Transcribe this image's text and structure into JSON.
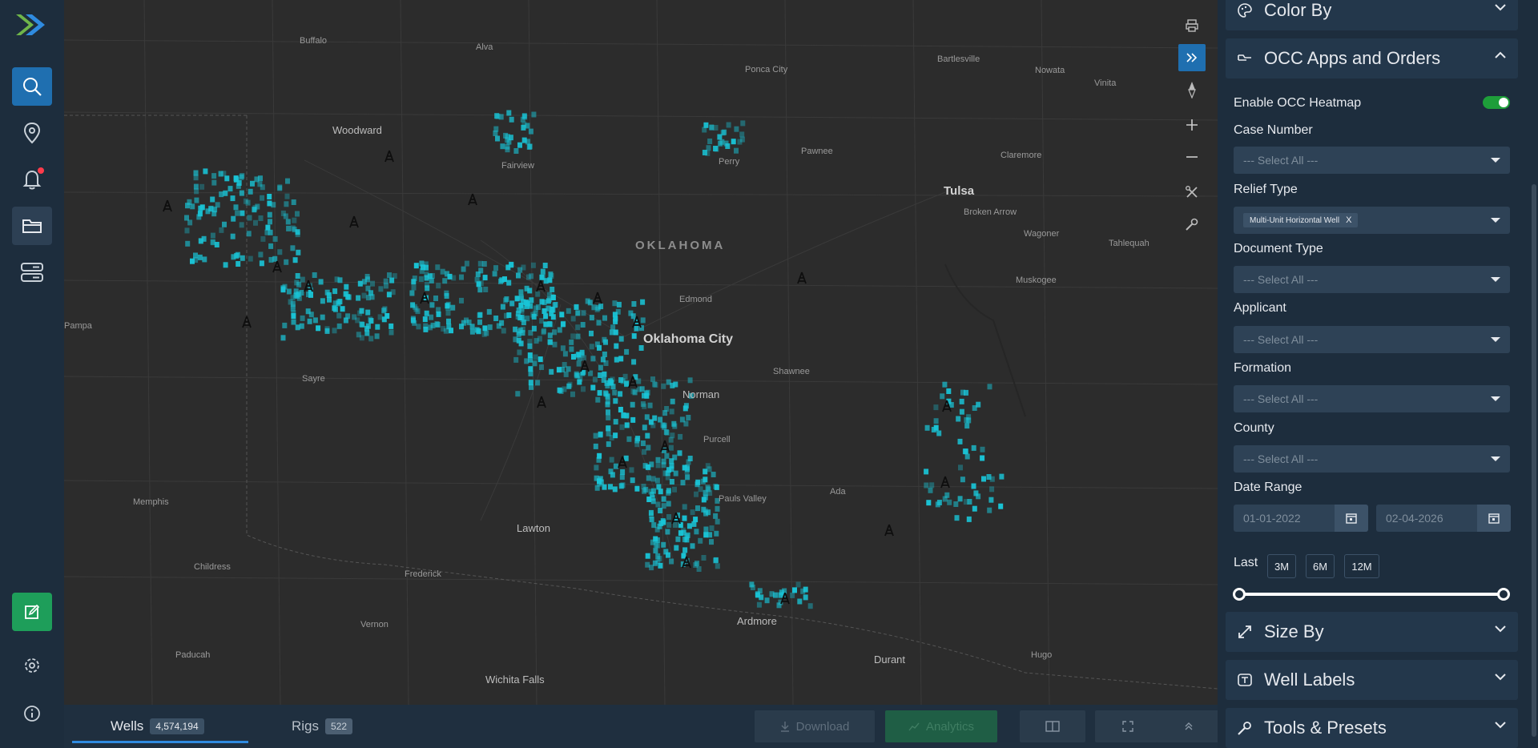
{
  "nav": {
    "items": [
      "search-icon",
      "location-pin-icon",
      "bell-icon",
      "folder-icon",
      "servers-icon"
    ],
    "accent": "#1f6fb0",
    "notification_color": "#ff3b4b"
  },
  "map": {
    "cities": [
      {
        "name": "Buffalo"
      },
      {
        "name": "Alva"
      },
      {
        "name": "Ponca City"
      },
      {
        "name": "Bartlesville"
      },
      {
        "name": "Nowata"
      },
      {
        "name": "Vinita"
      },
      {
        "name": "Woodward"
      },
      {
        "name": "Fairview"
      },
      {
        "name": "Perry"
      },
      {
        "name": "Pawnee"
      },
      {
        "name": "Claremore"
      },
      {
        "name": "Broken Arrow"
      },
      {
        "name": "Wagoner"
      },
      {
        "name": "Tahlequah"
      },
      {
        "name": "Edmond"
      },
      {
        "name": "Muskogee"
      },
      {
        "name": "Pampa"
      },
      {
        "name": "Shawnee"
      },
      {
        "name": "Sayre"
      },
      {
        "name": "Norman"
      },
      {
        "name": "Purcell"
      },
      {
        "name": "Memphis"
      },
      {
        "name": "Pauls Valley"
      },
      {
        "name": "Ada"
      },
      {
        "name": "Lawton"
      },
      {
        "name": "Childress"
      },
      {
        "name": "Frederick"
      },
      {
        "name": "Vernon"
      },
      {
        "name": "Ardmore"
      },
      {
        "name": "Durant"
      },
      {
        "name": "Hugo"
      },
      {
        "name": "Paducah"
      },
      {
        "name": "Wichita Falls"
      }
    ],
    "major_cities": [
      "Tulsa",
      "Oklahoma City"
    ],
    "state_label": "OKLAHOMA",
    "heat_color": "#19c4d6"
  },
  "bottom": {
    "tabs": [
      {
        "label": "Wells",
        "count": "4,574,194"
      },
      {
        "label": "Rigs",
        "count": "522"
      }
    ],
    "download_label": "Download",
    "analytics_label": "Analytics"
  },
  "panel": {
    "color_by": "Color By",
    "occ_title": "OCC Apps and Orders",
    "enable_heatmap": "Enable OCC Heatmap",
    "fields": {
      "case_number": {
        "label": "Case Number",
        "placeholder": "--- Select All ---"
      },
      "relief_type": {
        "label": "Relief Type",
        "chip": "Multi-Unit Horizontal Well",
        "chip_remove": "X"
      },
      "document_type": {
        "label": "Document Type",
        "placeholder": "--- Select All ---"
      },
      "applicant": {
        "label": "Applicant",
        "placeholder": "--- Select All ---"
      },
      "formation": {
        "label": "Formation",
        "placeholder": "--- Select All ---"
      },
      "county": {
        "label": "County",
        "placeholder": "--- Select All ---"
      }
    },
    "date_range": {
      "label": "Date Range",
      "start": "01-01-2022",
      "end": "02-04-2026"
    },
    "last": {
      "label": "Last",
      "options": [
        "3M",
        "6M",
        "12M"
      ]
    },
    "size_by": "Size By",
    "well_labels": "Well Labels",
    "tools_presets": "Tools & Presets",
    "toggle_color": "#1e9e3a"
  }
}
